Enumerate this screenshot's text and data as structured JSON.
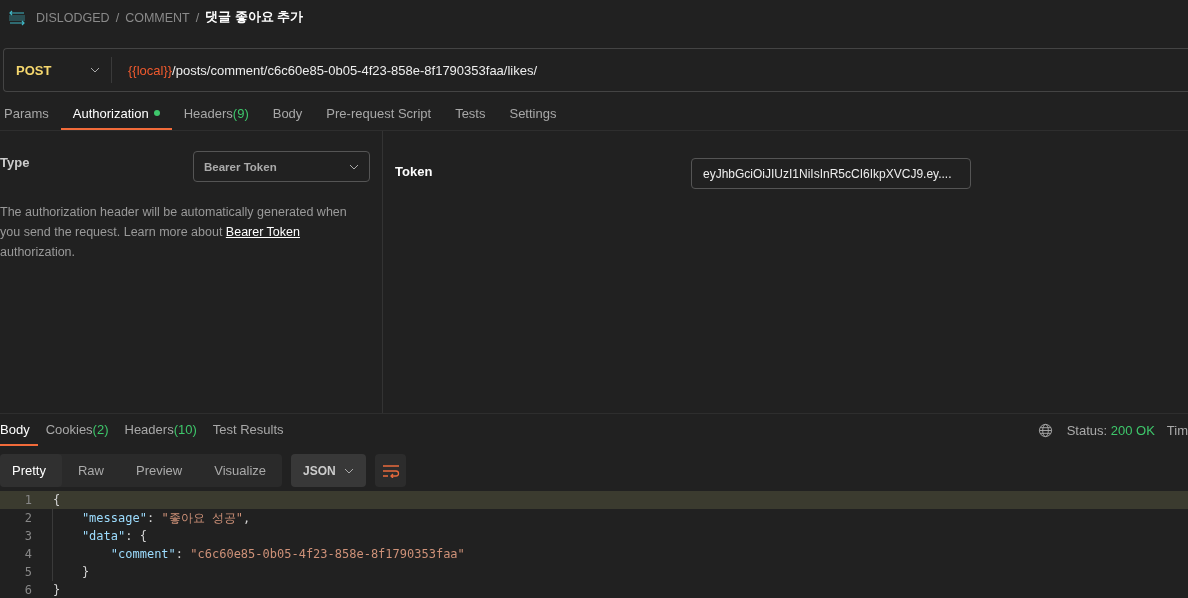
{
  "breadcrumb": {
    "items": [
      "DISLODGED",
      "COMMENT"
    ],
    "separator": "/",
    "current": "댓글 좋아요 추가"
  },
  "request": {
    "method": "POST",
    "url_variable": "{{local}}",
    "url_path": "/posts/comment/c6c60e85-0b05-4f23-858e-8f1790353faa/likes/"
  },
  "tabs": [
    {
      "label": "Params",
      "selected": false,
      "dot": false
    },
    {
      "label": "Authorization",
      "selected": true,
      "dot": true
    },
    {
      "label": "Headers",
      "selected": false,
      "count": "(9)",
      "dot": false
    },
    {
      "label": "Body",
      "selected": false,
      "dot": false
    },
    {
      "label": "Pre-request Script",
      "selected": false,
      "dot": false
    },
    {
      "label": "Tests",
      "selected": false,
      "dot": false
    },
    {
      "label": "Settings",
      "selected": false,
      "dot": false
    }
  ],
  "auth": {
    "type_label": "Type",
    "type_value": "Bearer Token",
    "description_before": "The authorization header will be automatically generated when you send the request. Learn more about ",
    "link": "Bearer Token",
    "description_after": " authorization.",
    "token_label": "Token",
    "token_value": "eyJhbGciOiJIUzI1NiIsInR5cCI6IkpXVCJ9.ey...."
  },
  "response": {
    "tabs": [
      {
        "label": "Body",
        "selected": true
      },
      {
        "label": "Cookies",
        "selected": false,
        "count": "(2)"
      },
      {
        "label": "Headers",
        "selected": false,
        "count": "(10)"
      },
      {
        "label": "Test Results",
        "selected": false
      }
    ],
    "status_label": "Status:",
    "status_value": "200 OK",
    "time_label": "Tim",
    "views": [
      {
        "label": "Pretty",
        "selected": true
      },
      {
        "label": "Raw",
        "selected": false
      },
      {
        "label": "Preview",
        "selected": false
      },
      {
        "label": "Visualize",
        "selected": false
      }
    ],
    "format": "JSON",
    "lines": [
      {
        "number": "1",
        "highlighted": true,
        "guide": false,
        "tokens": [
          {
            "kind": "punct",
            "text": "{"
          }
        ]
      },
      {
        "number": "2",
        "highlighted": false,
        "guide": true,
        "tokens": [
          {
            "kind": "key",
            "text": "    \"message\""
          },
          {
            "kind": "punct",
            "text": ": "
          },
          {
            "kind": "string",
            "text": "\"좋아요 성공\""
          },
          {
            "kind": "punct",
            "text": ","
          }
        ]
      },
      {
        "number": "3",
        "highlighted": false,
        "guide": true,
        "tokens": [
          {
            "kind": "key",
            "text": "    \"data\""
          },
          {
            "kind": "punct",
            "text": ": {"
          }
        ]
      },
      {
        "number": "4",
        "highlighted": false,
        "guide": true,
        "tokens": [
          {
            "kind": "key",
            "text": "        \"comment\""
          },
          {
            "kind": "punct",
            "text": ": "
          },
          {
            "kind": "string",
            "text": "\"c6c60e85-0b05-4f23-858e-8f1790353faa\""
          }
        ]
      },
      {
        "number": "5",
        "highlighted": false,
        "guide": true,
        "tokens": [
          {
            "kind": "punct",
            "text": "    }"
          }
        ]
      },
      {
        "number": "6",
        "highlighted": false,
        "guide": false,
        "tokens": [
          {
            "kind": "punct",
            "text": "}"
          }
        ]
      }
    ]
  }
}
